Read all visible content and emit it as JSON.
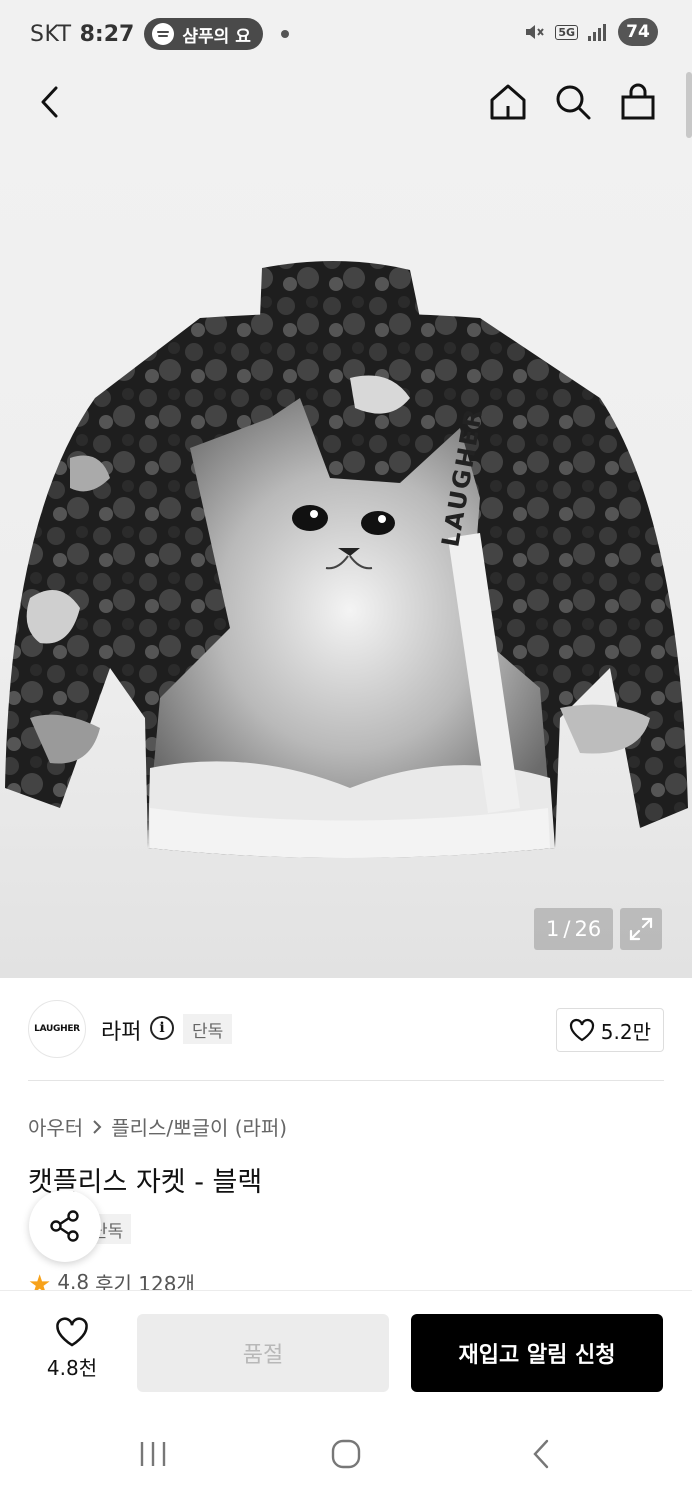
{
  "status_bar": {
    "carrier": "SKT",
    "time": "8:27",
    "media_text": "샴푸의 요",
    "network": "5G",
    "battery": "74"
  },
  "header": {
    "icons": [
      "back-icon",
      "home-icon",
      "search-icon",
      "bag-icon"
    ]
  },
  "gallery": {
    "current": "1",
    "separator": "/",
    "total": "26"
  },
  "brand": {
    "logo_text": "LAUGHER",
    "name": "라퍼",
    "badge": "단독",
    "likes": "5.2만"
  },
  "product": {
    "breadcrumb": [
      "아우터",
      "플리스/뽀글이 (라퍼)"
    ],
    "title": "캣플리스 자켓 - 블랙",
    "badge": "단독",
    "rating": "4.8",
    "reviews": "후기 128개"
  },
  "actions": {
    "wish_count": "4.8천",
    "soldout_label": "품절",
    "restock_label": "재입고 알림 신청"
  },
  "colors": {
    "primary_button": "#000000",
    "disabled_button": "#ececec",
    "star": "#f7a21b"
  }
}
